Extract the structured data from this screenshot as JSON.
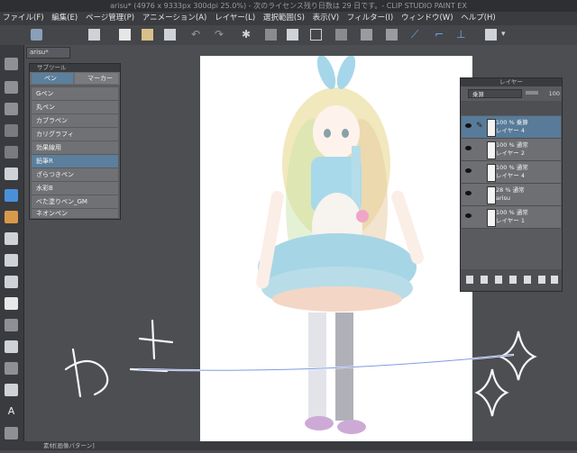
{
  "window": {
    "title": "arisu* (4976 x 9333px 300dpi 25.0%)  - 次のライセンス残り日数は 29 日です。- CLIP STUDIO PAINT EX"
  },
  "menu": [
    "ファイル(F)",
    "編集(E)",
    "ページ管理(P)",
    "アニメーション(A)",
    "レイヤー(L)",
    "選択範囲(S)",
    "表示(V)",
    "フィルター(I)",
    "ウィンドウ(W)",
    "ヘルプ(H)"
  ],
  "document_tab": "arisu*",
  "subtool_panel": {
    "header": "サブツール",
    "tabs": [
      "ペン",
      "マーカー"
    ],
    "items": [
      "Gペン",
      "丸ペン",
      "カブラペン",
      "カリグラフィ",
      "効果線用",
      "鉛筆R",
      "ざらつきペン",
      "水彩B",
      "べた塗りペン_GM",
      "ネオンペン"
    ],
    "selected_index": 5
  },
  "layer_panel": {
    "header": "レイヤー",
    "blend_mode": "乗算",
    "opacity": "100",
    "layers": [
      {
        "line1": "100 % 乗算",
        "line2": "レイヤー 4",
        "selected": true
      },
      {
        "line1": "100 % 通常",
        "line2": "レイヤー 2",
        "selected": false
      },
      {
        "line1": "100 % 通常",
        "line2": "レイヤー 4",
        "selected": false
      },
      {
        "line1": "28 % 通常",
        "line2": "arisu",
        "selected": false
      },
      {
        "line1": "100 % 通常",
        "line2": "レイヤー 1",
        "selected": false
      }
    ]
  },
  "bottom_panel_label": "素材[画像パターン]",
  "colors": {
    "selection_blue": "#5b7f9c",
    "panel_bg": "#5c5d61",
    "canvas_bg": "#4d4e52"
  }
}
